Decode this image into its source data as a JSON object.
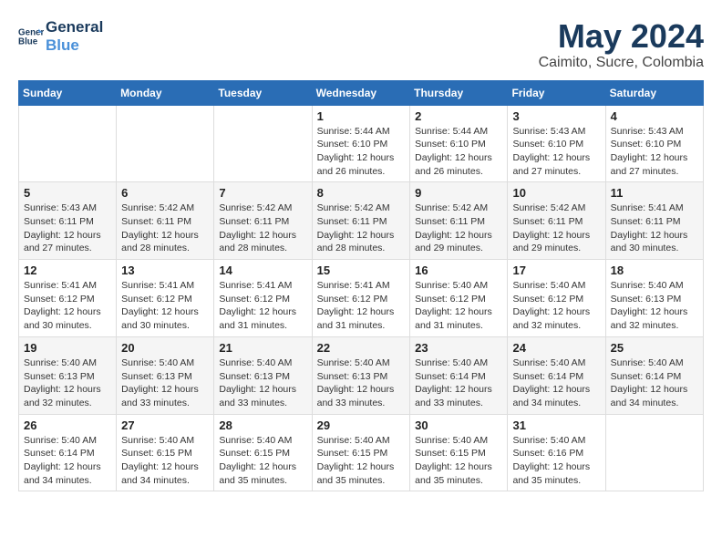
{
  "header": {
    "logo_line1": "General",
    "logo_line2": "Blue",
    "title": "May 2024",
    "subtitle": "Caimito, Sucre, Colombia"
  },
  "calendar": {
    "days_of_week": [
      "Sunday",
      "Monday",
      "Tuesday",
      "Wednesday",
      "Thursday",
      "Friday",
      "Saturday"
    ],
    "weeks": [
      [
        {
          "day": "",
          "info": ""
        },
        {
          "day": "",
          "info": ""
        },
        {
          "day": "",
          "info": ""
        },
        {
          "day": "1",
          "info": "Sunrise: 5:44 AM\nSunset: 6:10 PM\nDaylight: 12 hours\nand 26 minutes."
        },
        {
          "day": "2",
          "info": "Sunrise: 5:44 AM\nSunset: 6:10 PM\nDaylight: 12 hours\nand 26 minutes."
        },
        {
          "day": "3",
          "info": "Sunrise: 5:43 AM\nSunset: 6:10 PM\nDaylight: 12 hours\nand 27 minutes."
        },
        {
          "day": "4",
          "info": "Sunrise: 5:43 AM\nSunset: 6:10 PM\nDaylight: 12 hours\nand 27 minutes."
        }
      ],
      [
        {
          "day": "5",
          "info": "Sunrise: 5:43 AM\nSunset: 6:11 PM\nDaylight: 12 hours\nand 27 minutes."
        },
        {
          "day": "6",
          "info": "Sunrise: 5:42 AM\nSunset: 6:11 PM\nDaylight: 12 hours\nand 28 minutes."
        },
        {
          "day": "7",
          "info": "Sunrise: 5:42 AM\nSunset: 6:11 PM\nDaylight: 12 hours\nand 28 minutes."
        },
        {
          "day": "8",
          "info": "Sunrise: 5:42 AM\nSunset: 6:11 PM\nDaylight: 12 hours\nand 28 minutes."
        },
        {
          "day": "9",
          "info": "Sunrise: 5:42 AM\nSunset: 6:11 PM\nDaylight: 12 hours\nand 29 minutes."
        },
        {
          "day": "10",
          "info": "Sunrise: 5:42 AM\nSunset: 6:11 PM\nDaylight: 12 hours\nand 29 minutes."
        },
        {
          "day": "11",
          "info": "Sunrise: 5:41 AM\nSunset: 6:11 PM\nDaylight: 12 hours\nand 30 minutes."
        }
      ],
      [
        {
          "day": "12",
          "info": "Sunrise: 5:41 AM\nSunset: 6:12 PM\nDaylight: 12 hours\nand 30 minutes."
        },
        {
          "day": "13",
          "info": "Sunrise: 5:41 AM\nSunset: 6:12 PM\nDaylight: 12 hours\nand 30 minutes."
        },
        {
          "day": "14",
          "info": "Sunrise: 5:41 AM\nSunset: 6:12 PM\nDaylight: 12 hours\nand 31 minutes."
        },
        {
          "day": "15",
          "info": "Sunrise: 5:41 AM\nSunset: 6:12 PM\nDaylight: 12 hours\nand 31 minutes."
        },
        {
          "day": "16",
          "info": "Sunrise: 5:40 AM\nSunset: 6:12 PM\nDaylight: 12 hours\nand 31 minutes."
        },
        {
          "day": "17",
          "info": "Sunrise: 5:40 AM\nSunset: 6:12 PM\nDaylight: 12 hours\nand 32 minutes."
        },
        {
          "day": "18",
          "info": "Sunrise: 5:40 AM\nSunset: 6:13 PM\nDaylight: 12 hours\nand 32 minutes."
        }
      ],
      [
        {
          "day": "19",
          "info": "Sunrise: 5:40 AM\nSunset: 6:13 PM\nDaylight: 12 hours\nand 32 minutes."
        },
        {
          "day": "20",
          "info": "Sunrise: 5:40 AM\nSunset: 6:13 PM\nDaylight: 12 hours\nand 33 minutes."
        },
        {
          "day": "21",
          "info": "Sunrise: 5:40 AM\nSunset: 6:13 PM\nDaylight: 12 hours\nand 33 minutes."
        },
        {
          "day": "22",
          "info": "Sunrise: 5:40 AM\nSunset: 6:13 PM\nDaylight: 12 hours\nand 33 minutes."
        },
        {
          "day": "23",
          "info": "Sunrise: 5:40 AM\nSunset: 6:14 PM\nDaylight: 12 hours\nand 33 minutes."
        },
        {
          "day": "24",
          "info": "Sunrise: 5:40 AM\nSunset: 6:14 PM\nDaylight: 12 hours\nand 34 minutes."
        },
        {
          "day": "25",
          "info": "Sunrise: 5:40 AM\nSunset: 6:14 PM\nDaylight: 12 hours\nand 34 minutes."
        }
      ],
      [
        {
          "day": "26",
          "info": "Sunrise: 5:40 AM\nSunset: 6:14 PM\nDaylight: 12 hours\nand 34 minutes."
        },
        {
          "day": "27",
          "info": "Sunrise: 5:40 AM\nSunset: 6:15 PM\nDaylight: 12 hours\nand 34 minutes."
        },
        {
          "day": "28",
          "info": "Sunrise: 5:40 AM\nSunset: 6:15 PM\nDaylight: 12 hours\nand 35 minutes."
        },
        {
          "day": "29",
          "info": "Sunrise: 5:40 AM\nSunset: 6:15 PM\nDaylight: 12 hours\nand 35 minutes."
        },
        {
          "day": "30",
          "info": "Sunrise: 5:40 AM\nSunset: 6:15 PM\nDaylight: 12 hours\nand 35 minutes."
        },
        {
          "day": "31",
          "info": "Sunrise: 5:40 AM\nSunset: 6:16 PM\nDaylight: 12 hours\nand 35 minutes."
        },
        {
          "day": "",
          "info": ""
        }
      ]
    ]
  }
}
